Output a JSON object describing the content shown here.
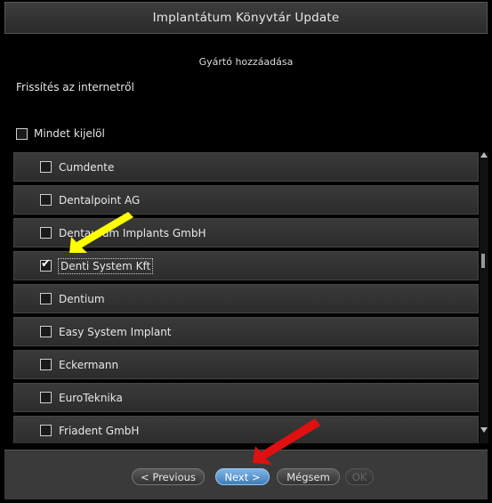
{
  "window": {
    "title": "Implantátum Könyvtár Update"
  },
  "header": {
    "subtitle": "Gyártó hozzáadása",
    "section": "Frissítés az internetről"
  },
  "select_all": {
    "label": "Mindet kijelöl",
    "checked": false
  },
  "manufacturers": [
    {
      "name": "Cumdente",
      "checked": false
    },
    {
      "name": "Dentalpoint AG",
      "checked": false
    },
    {
      "name": "Dentaurum Implants GmbH",
      "checked": false
    },
    {
      "name": "Denti System Kft",
      "checked": true
    },
    {
      "name": "Dentium",
      "checked": false
    },
    {
      "name": "Easy System Implant",
      "checked": false
    },
    {
      "name": "Eckermann",
      "checked": false
    },
    {
      "name": "EuroTeknika",
      "checked": false
    },
    {
      "name": "Friadent GmbH",
      "checked": false
    }
  ],
  "footer": {
    "previous": "< Previous",
    "next": "Next >",
    "cancel": "Mégsem",
    "ok": "OK"
  },
  "colors": {
    "highlight_arrow": "#ffff00",
    "pointer_arrow": "#e01010",
    "primary_button": "#4f8dc8"
  },
  "annotations": [
    {
      "icon": "yellow-arrow-icon",
      "points_to": "Denti System Kft"
    },
    {
      "icon": "red-arrow-icon",
      "points_to": "Next >"
    }
  ]
}
